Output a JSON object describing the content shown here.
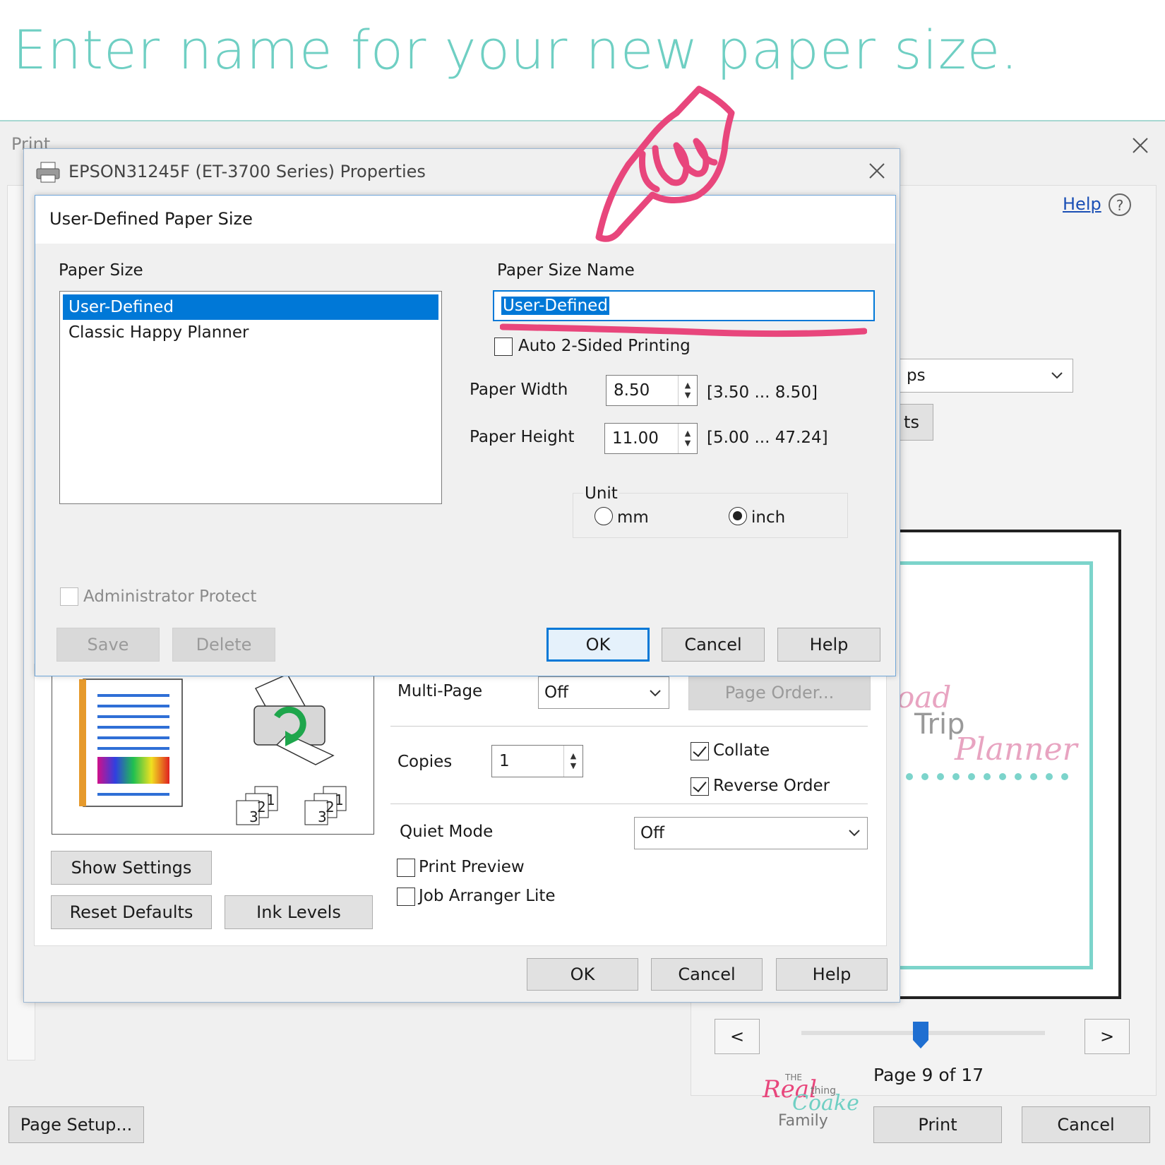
{
  "headline": "Enter name for your new paper size.",
  "print_window": {
    "title": "Print",
    "help_link": "Help",
    "dropdown_partial": "ps",
    "button_partial": "ts",
    "preview": {
      "logo_line1": "oad",
      "logo_line2": "Trip",
      "logo_line3": "Planner",
      "nav_prev": "<",
      "nav_next": ">",
      "page_indicator": "Page 9 of 17",
      "slider_level": 0.49
    },
    "page_setup_button": "Page Setup...",
    "print_button": "Print",
    "cancel_button": "Cancel",
    "watermark": {
      "small1": "THE",
      "big1": "Real",
      "small2": "thing",
      "big2": "Coake",
      "word3": "Family"
    }
  },
  "properties_dialog": {
    "title": "EPSON31245F (ET-3700 Series) Properties",
    "multi_page_label": "Multi-Page",
    "multi_page_value": "Off",
    "page_order_button": "Page Order...",
    "copies_label": "Copies",
    "copies_value": "1",
    "collate_label": "Collate",
    "reverse_order_label": "Reverse Order",
    "quiet_mode_label": "Quiet Mode",
    "quiet_mode_value": "Off",
    "print_preview_label": "Print Preview",
    "job_arranger_label": "Job Arranger Lite",
    "show_settings_button": "Show Settings",
    "reset_defaults_button": "Reset Defaults",
    "ink_levels_button": "Ink Levels",
    "stack1": [
      "3",
      "2",
      "1"
    ],
    "stack2": [
      "3",
      "2",
      "1"
    ],
    "ok_button": "OK",
    "cancel_button": "Cancel",
    "help_button": "Help"
  },
  "user_defined_dialog": {
    "title": "User-Defined Paper Size",
    "paper_size_label": "Paper Size",
    "paper_sizes": [
      "User-Defined",
      "Classic Happy Planner"
    ],
    "paper_size_name_label": "Paper Size Name",
    "paper_size_name_value": "User-Defined",
    "auto_2_sided_label": "Auto 2-Sided Printing",
    "paper_width_label": "Paper Width",
    "paper_width_value": "8.50",
    "paper_width_range": "[3.50 ... 8.50]",
    "paper_height_label": "Paper Height",
    "paper_height_value": "11.00",
    "paper_height_range": "[5.00 ... 47.24]",
    "unit_label": "Unit",
    "unit_mm": "mm",
    "unit_inch": "inch",
    "admin_protect_label": "Administrator Protect",
    "save_button": "Save",
    "delete_button": "Delete",
    "ok_button": "OK",
    "cancel_button": "Cancel",
    "help_button": "Help"
  },
  "colors": {
    "headline": "#6fcfc3",
    "annotation": "#e8467c",
    "selection": "#0078d7"
  }
}
